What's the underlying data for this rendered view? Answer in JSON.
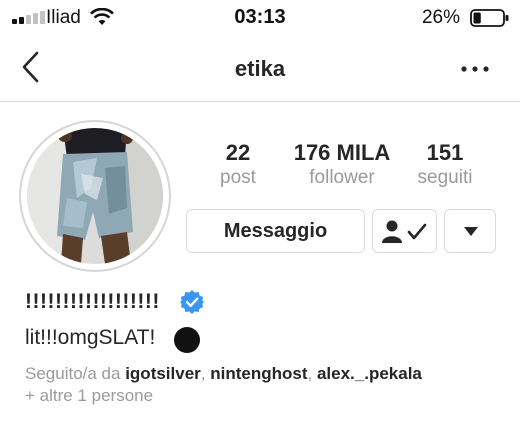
{
  "status_bar": {
    "carrier": "Iliad",
    "time": "03:13",
    "battery_percent": "26%",
    "battery_level": 0.26,
    "signal_bars_active": 2,
    "signal_bars_total": 5
  },
  "nav": {
    "username": "etika",
    "back_icon": "chevron-left-icon",
    "more_icon": "more-horizontal-icon"
  },
  "profile": {
    "stats": [
      {
        "value": "22",
        "label": "post"
      },
      {
        "value": "176 MILA",
        "label": "follower"
      },
      {
        "value": "151",
        "label": "seguiti"
      }
    ],
    "actions": {
      "message_label": "Messaggio",
      "following_icon": "person-check-icon",
      "dropdown_icon": "caret-down-icon"
    },
    "display_name": "!!!!!!!!!!!!!!!!!!",
    "verified": true,
    "bio": "lit!!!omgSLAT!",
    "followed_by": {
      "prefix": "Seguito/a da ",
      "users": [
        "igotsilver",
        "nintenghost",
        "alex._.pekala"
      ],
      "more": "+ altre 1 persone"
    }
  },
  "colors": {
    "text_primary": "#262626",
    "text_secondary": "#9a9a9a",
    "border": "#dbdbdb",
    "verified_blue": "#3897f0"
  }
}
